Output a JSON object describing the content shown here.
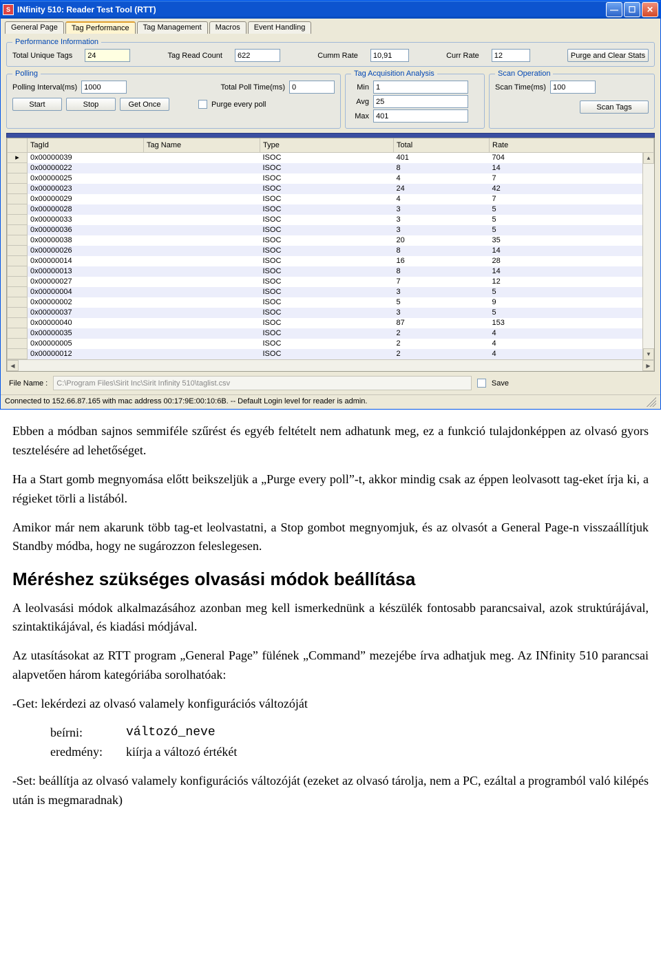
{
  "window": {
    "title": "INfinity 510: Reader Test Tool (RTT)",
    "app_icon_letter": "S"
  },
  "tabs": [
    "General Page",
    "Tag Performance",
    "Tag Management",
    "Macros",
    "Event Handling"
  ],
  "active_tab": 1,
  "perf": {
    "legend": "Performance Information",
    "unique_tags_label": "Total Unique Tags",
    "unique_tags": "24",
    "read_count_label": "Tag Read Count",
    "read_count": "622",
    "cumm_rate_label": "Cumm Rate",
    "cumm_rate": "10,91",
    "curr_rate_label": "Curr Rate",
    "curr_rate": "12",
    "purge_btn": "Purge and Clear Stats"
  },
  "polling": {
    "legend": "Polling",
    "interval_label": "Polling Interval(ms)",
    "interval": "1000",
    "total_time_label": "Total Poll Time(ms)",
    "total_time": "0",
    "start": "Start",
    "stop": "Stop",
    "get_once": "Get Once",
    "purge_every_poll": "Purge every poll"
  },
  "acq": {
    "legend": "Tag Acquisition Analysis",
    "min_label": "Min",
    "min": "1",
    "avg_label": "Avg",
    "avg": "25",
    "max_label": "Max",
    "max": "401"
  },
  "scan": {
    "legend": "Scan Operation",
    "time_label": "Scan Time(ms)",
    "time": "100",
    "btn": "Scan Tags"
  },
  "grid": {
    "headers": [
      "TagId",
      "Tag Name",
      "Type",
      "Total",
      "Rate"
    ],
    "rows": [
      {
        "id": "0x00000039",
        "name": "",
        "type": "ISOC",
        "total": "401",
        "rate": "704"
      },
      {
        "id": "0x00000022",
        "name": "",
        "type": "ISOC",
        "total": "8",
        "rate": "14"
      },
      {
        "id": "0x00000025",
        "name": "",
        "type": "ISOC",
        "total": "4",
        "rate": "7"
      },
      {
        "id": "0x00000023",
        "name": "",
        "type": "ISOC",
        "total": "24",
        "rate": "42"
      },
      {
        "id": "0x00000029",
        "name": "",
        "type": "ISOC",
        "total": "4",
        "rate": "7"
      },
      {
        "id": "0x00000028",
        "name": "",
        "type": "ISOC",
        "total": "3",
        "rate": "5"
      },
      {
        "id": "0x00000033",
        "name": "",
        "type": "ISOC",
        "total": "3",
        "rate": "5"
      },
      {
        "id": "0x00000036",
        "name": "",
        "type": "ISOC",
        "total": "3",
        "rate": "5"
      },
      {
        "id": "0x00000038",
        "name": "",
        "type": "ISOC",
        "total": "20",
        "rate": "35"
      },
      {
        "id": "0x00000026",
        "name": "",
        "type": "ISOC",
        "total": "8",
        "rate": "14"
      },
      {
        "id": "0x00000014",
        "name": "",
        "type": "ISOC",
        "total": "16",
        "rate": "28"
      },
      {
        "id": "0x00000013",
        "name": "",
        "type": "ISOC",
        "total": "8",
        "rate": "14"
      },
      {
        "id": "0x00000027",
        "name": "",
        "type": "ISOC",
        "total": "7",
        "rate": "12"
      },
      {
        "id": "0x00000004",
        "name": "",
        "type": "ISOC",
        "total": "3",
        "rate": "5"
      },
      {
        "id": "0x00000002",
        "name": "",
        "type": "ISOC",
        "total": "5",
        "rate": "9"
      },
      {
        "id": "0x00000037",
        "name": "",
        "type": "ISOC",
        "total": "3",
        "rate": "5"
      },
      {
        "id": "0x00000040",
        "name": "",
        "type": "ISOC",
        "total": "87",
        "rate": "153"
      },
      {
        "id": "0x00000035",
        "name": "",
        "type": "ISOC",
        "total": "2",
        "rate": "4"
      },
      {
        "id": "0x00000005",
        "name": "",
        "type": "ISOC",
        "total": "2",
        "rate": "4"
      },
      {
        "id": "0x00000012",
        "name": "",
        "type": "ISOC",
        "total": "2",
        "rate": "4"
      }
    ]
  },
  "file": {
    "label": "File Name :",
    "path": "C:\\Program Files\\Sirit Inc\\Sirit Infinity 510\\taglist.csv",
    "save_label": "Save"
  },
  "status": "Connected to 152.66.87.165 with mac address 00:17:9E:00:10:6B. -- Default Login level for reader is admin.",
  "doc": {
    "p1": "Ebben a módban sajnos semmiféle szűrést és egyéb feltételt nem adhatunk meg, ez a funkció tulajdonképpen az olvasó gyors tesztelésére ad lehetőséget.",
    "p2": "Ha a Start gomb megnyomása előtt beikszeljük a „Purge every poll”-t, akkor mindig csak az éppen leolvasott tag-eket írja ki, a régieket törli a listából.",
    "p3": "Amikor már nem akarunk több tag-et leolvastatni, a Stop gombot megnyomjuk, és az olvasót a General Page-n visszaállítjuk Standby módba, hogy ne sugározzon feleslegesen.",
    "h2": "Méréshez szükséges olvasási módok beállítása",
    "p4": "A leolvasási módok alkalmazásához azonban meg kell ismerkednünk a készülék fontosabb parancsaival, azok struktúrájával, szintaktikájával, és kiadási módjával.",
    "p5": "Az utasításokat az RTT program „General Page” fülének „Command” mezejébe írva adhatjuk meg. Az INfinity 510 parancsai alapvetően három kategóriába sorolhatóak:",
    "get_title": "-Get: lekérdezi az olvasó valamely konfigurációs változóját",
    "get_write_k": "beírni:",
    "get_write_v": "változó_neve",
    "get_res_k": "eredmény:",
    "get_res_v": "kiírja a változó értékét",
    "set_title": "-Set: beállítja az olvasó valamely konfigurációs változóját (ezeket az olvasó tárolja, nem a PC, ezáltal a programból való kilépés után is megmaradnak)"
  }
}
